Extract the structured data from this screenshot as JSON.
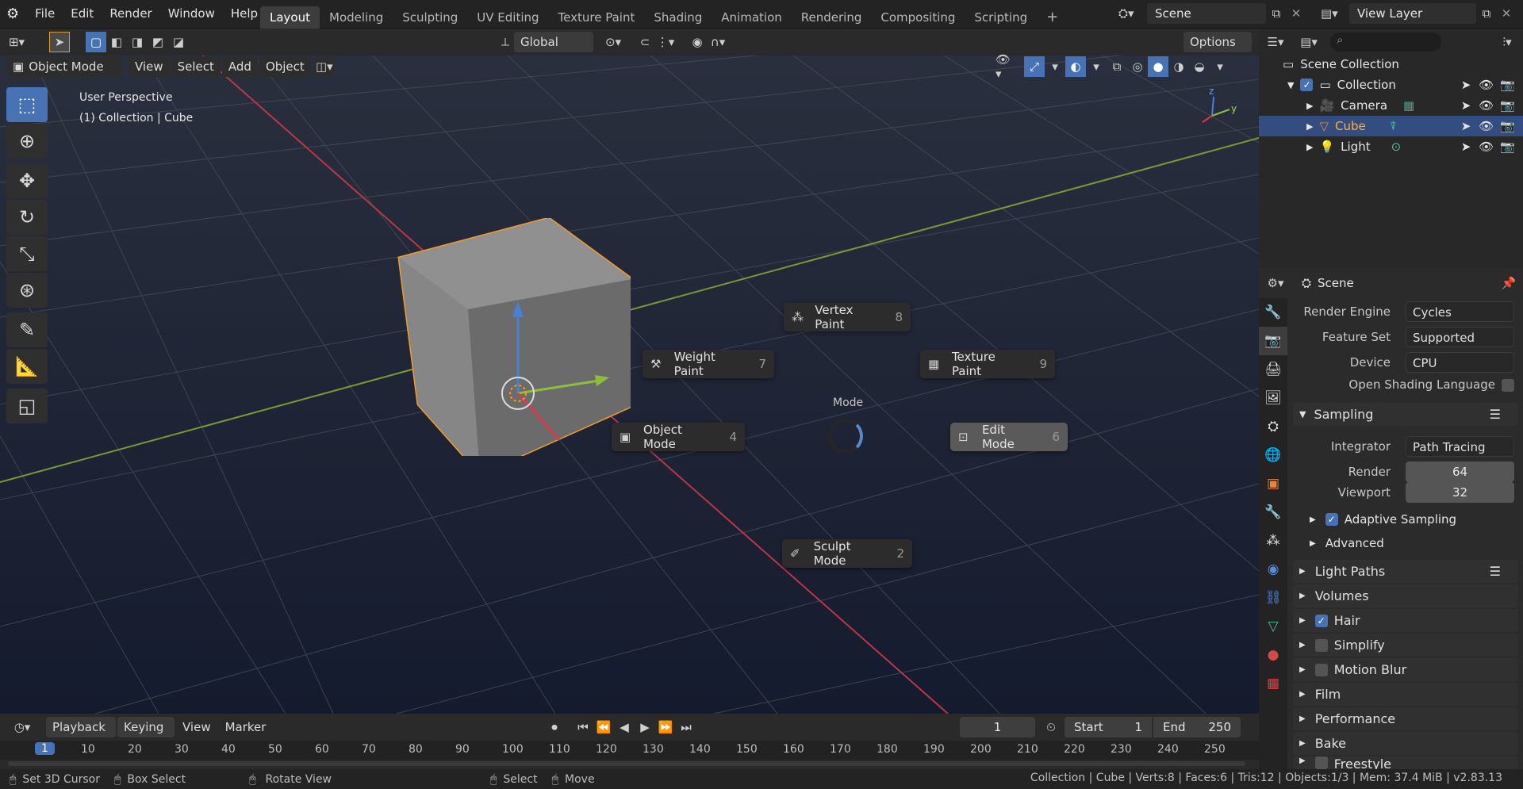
{
  "topbar": {
    "menus": [
      "File",
      "Edit",
      "Render",
      "Window",
      "Help"
    ],
    "workspaces": [
      "Layout",
      "Modeling",
      "Sculpting",
      "UV Editing",
      "Texture Paint",
      "Shading",
      "Animation",
      "Rendering",
      "Compositing",
      "Scripting"
    ],
    "active_workspace": "Layout",
    "scene": "Scene",
    "view_layer": "View Layer"
  },
  "tool_header": {
    "orientation": "Global",
    "options": "Options"
  },
  "viewport_header": {
    "mode": "Object Mode",
    "menus": [
      "View",
      "Select",
      "Add",
      "Object"
    ]
  },
  "viewport": {
    "perspective_label": "User Perspective",
    "collection_label": "(1) Collection | Cube",
    "gizmo_axes": [
      "z",
      "y"
    ]
  },
  "pie_menu": {
    "title": "Mode",
    "items": [
      {
        "label": "Vertex Paint",
        "key": "8",
        "icon": "vertex-paint-icon"
      },
      {
        "label": "Weight Paint",
        "key": "7",
        "icon": "weight-paint-icon"
      },
      {
        "label": "Texture Paint",
        "key": "9",
        "icon": "texture-paint-icon"
      },
      {
        "label": "Object Mode",
        "key": "4",
        "icon": "object-mode-icon"
      },
      {
        "label": "Edit Mode",
        "key": "6",
        "icon": "edit-mode-icon"
      },
      {
        "label": "Sculpt Mode",
        "key": "2",
        "icon": "sculpt-mode-icon"
      }
    ]
  },
  "outliner": {
    "root": "Scene Collection",
    "items": [
      {
        "label": "Collection",
        "selected": false
      },
      {
        "label": "Camera",
        "selected": false
      },
      {
        "label": "Cube",
        "selected": true
      },
      {
        "label": "Light",
        "selected": false
      }
    ]
  },
  "properties": {
    "context": "Scene",
    "render_engine_label": "Render Engine",
    "render_engine": "Cycles",
    "feature_set_label": "Feature Set",
    "feature_set": "Supported",
    "device_label": "Device",
    "device": "CPU",
    "osl_label": "Open Shading Language",
    "sampling": "Sampling",
    "integrator_label": "Integrator",
    "integrator": "Path Tracing",
    "render_label": "Render",
    "render_samples": "64",
    "viewport_label": "Viewport",
    "viewport_samples": "32",
    "adaptive_sampling": "Adaptive Sampling",
    "advanced": "Advanced",
    "panels": [
      "Light Paths",
      "Volumes",
      "Hair",
      "Simplify",
      "Motion Blur",
      "Film",
      "Performance",
      "Bake",
      "Freestyle"
    ]
  },
  "timeline": {
    "menus": [
      "Playback",
      "Keying",
      "View",
      "Marker"
    ],
    "current_frame": "1",
    "start_label": "Start",
    "start": "1",
    "end_label": "End",
    "end": "250",
    "ruler": [
      "1",
      "10",
      "20",
      "30",
      "40",
      "50",
      "60",
      "70",
      "80",
      "90",
      "100",
      "110",
      "120",
      "130",
      "140",
      "150",
      "160",
      "170",
      "180",
      "190",
      "200",
      "210",
      "220",
      "230",
      "240",
      "250"
    ]
  },
  "statusbar": {
    "hint1": "Set 3D Cursor",
    "hint2": "Box Select",
    "hint3": "Rotate View",
    "hint4": "Select",
    "hint5": "Move",
    "stats": "Collection | Cube | Verts:8 | Faces:6 | Tris:12 | Objects:1/3 | Mem: 37.4 MiB | v2.83.13"
  },
  "colors": {
    "accent": "#4772b3",
    "selection_orange": "#f29b28",
    "x_axis": "#d63b4f",
    "y_axis": "#8cbf3a",
    "z_axis": "#4a7fd6"
  }
}
